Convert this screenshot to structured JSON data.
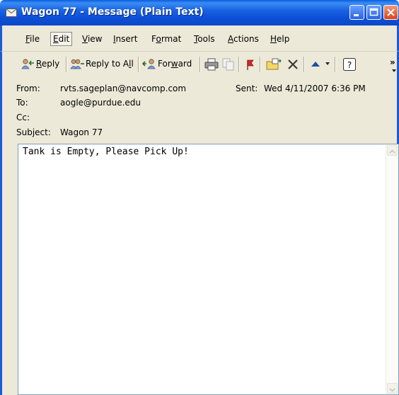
{
  "window": {
    "title": "Wagon 77 - Message (Plain Text)",
    "title_icon": "envelope-icon",
    "controls": [
      "minimize-icon",
      "maximize-icon",
      "close-icon"
    ]
  },
  "menu": [
    {
      "label": "File",
      "underline": "F",
      "rest": "ile"
    },
    {
      "label": "Edit",
      "underline": "E",
      "rest": "dit"
    },
    {
      "label": "View",
      "underline": "V",
      "rest": "iew"
    },
    {
      "label": "Insert",
      "underline": "I",
      "rest": "nsert"
    },
    {
      "label": "Format",
      "pre": "F",
      "underline": "o",
      "rest": "rmat"
    },
    {
      "label": "Tools",
      "underline": "T",
      "rest": "ools"
    },
    {
      "label": "Actions",
      "underline": "A",
      "rest": "ctions"
    },
    {
      "label": "Help",
      "underline": "H",
      "rest": "elp"
    }
  ],
  "toolbar": {
    "reply": {
      "label": "Reply",
      "underline": "R",
      "rest": "eply",
      "icon": "reply-icon"
    },
    "reply_all": {
      "label": "Reply to All",
      "pre": "Reply to A",
      "underline": "l",
      "rest": "l",
      "icon": "reply-all-icon"
    },
    "forward": {
      "label": "Forward",
      "pre": "For",
      "underline": "w",
      "rest": "ard",
      "icon": "forward-icon"
    },
    "icons": [
      "print-icon",
      "copy-icon",
      "flag-icon",
      "move-to-folder-icon",
      "delete-icon",
      "previous-item-icon",
      "dropdown-arrow-icon",
      "help-icon",
      "toolbar-options-icon"
    ],
    "overflow": "»"
  },
  "header": {
    "from_label": "From:",
    "from_value": "rvts.sageplan@navcomp.com",
    "sent_label": "Sent:",
    "sent_value": "Wed 4/11/2007 6:36 PM",
    "to_label": "To:",
    "to_value": "aogle@purdue.edu",
    "cc_label": "Cc:",
    "cc_value": "",
    "subject_label": "Subject:",
    "subject_value": "Wagon 77"
  },
  "body": {
    "text": "Tank is Empty, Please Pick Up!"
  },
  "colors": {
    "titlebar": "#0d4fd6",
    "chrome": "#ece9d8",
    "close_button": "#d9441c"
  }
}
